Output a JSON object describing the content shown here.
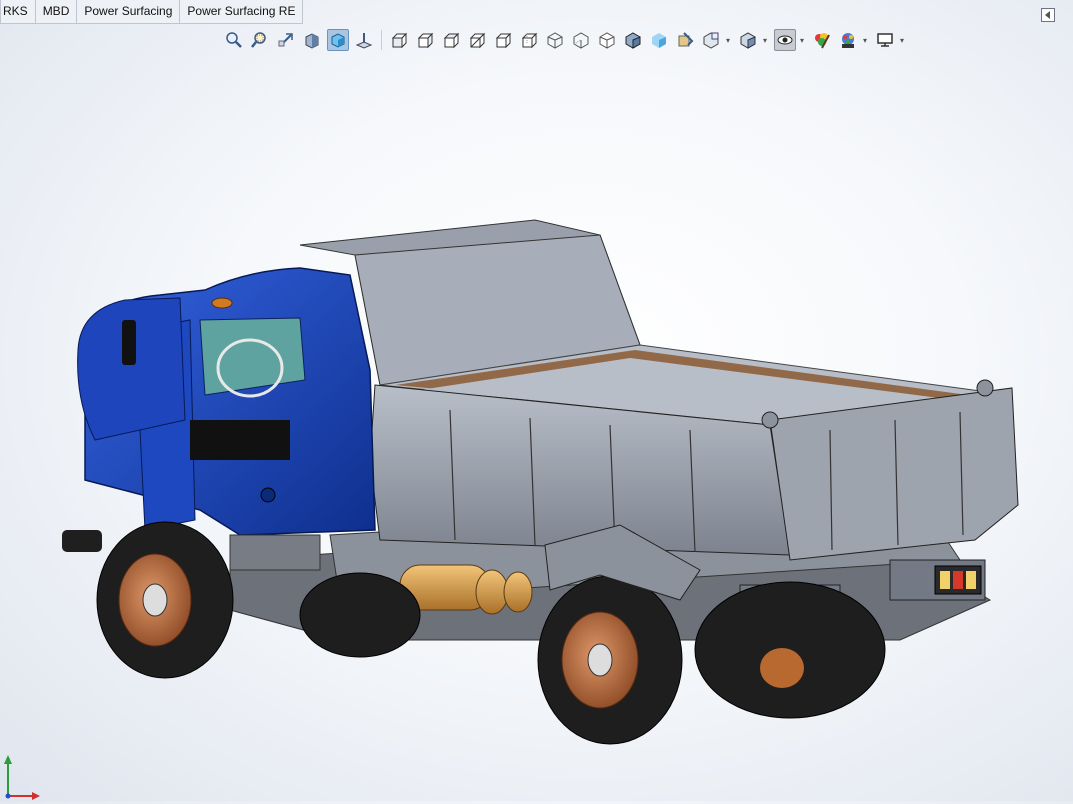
{
  "tabs": [
    "RKS",
    "MBD",
    "Power Surfacing",
    "Power Surfacing RE"
  ],
  "heads_up_toolbar": {
    "icons": [
      "zoom-to-fit-icon",
      "zoom-to-area-icon",
      "previous-view-icon",
      "section-view-icon",
      "view-orientation-icon",
      "normal-to-icon",
      "front-view-icon",
      "back-view-icon",
      "left-view-icon",
      "right-view-icon",
      "top-view-icon",
      "bottom-view-icon",
      "wireframe-icon",
      "hidden-lines-visible-icon",
      "hidden-lines-removed-icon",
      "shaded-with-edges-icon",
      "shaded-icon",
      "view-setting-icon",
      "apply-scene-icon",
      "display-style-icon",
      "hide-show-items-icon",
      "edit-appearance-icon",
      "apply-appearance-icon",
      "view-settings-monitor-icon"
    ]
  },
  "colors": {
    "cab_blue": "#1a3fb0",
    "body_gray": "#8e949f",
    "tire_black": "#1e1e1e",
    "rim_copper": "#b86a3c",
    "wood_floor": "#8a5a33",
    "tank_tan": "#d9a24a"
  },
  "triad": {
    "axis_y": "Y",
    "axis_x": "X"
  }
}
